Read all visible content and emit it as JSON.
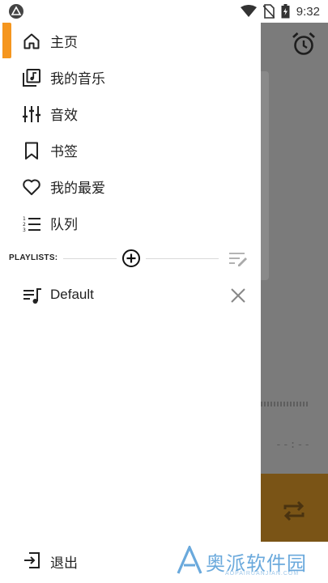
{
  "status_bar": {
    "time": "9:32"
  },
  "drawer": {
    "nav_items": [
      {
        "label": "主页",
        "icon": "home-icon",
        "active": true
      },
      {
        "label": "我的音乐",
        "icon": "music-library-icon",
        "active": false
      },
      {
        "label": "音效",
        "icon": "equalizer-icon",
        "active": false
      },
      {
        "label": "书签",
        "icon": "bookmark-icon",
        "active": false
      },
      {
        "label": "我的最爱",
        "icon": "heart-icon",
        "active": false
      },
      {
        "label": "队列",
        "icon": "queue-list-icon",
        "active": false
      }
    ],
    "playlists_label": "PLAYLISTS:",
    "playlists": [
      {
        "label": "Default"
      }
    ],
    "exit_label": "退出"
  },
  "background": {
    "time_readout": "--:--"
  },
  "watermark": {
    "text": "奥派软件园",
    "sub": "AOPAIRUANJIAN.COM"
  },
  "colors": {
    "accent": "#f5961f",
    "drawer_bg": "#ffffff",
    "scrim": "#7b7b7b"
  }
}
